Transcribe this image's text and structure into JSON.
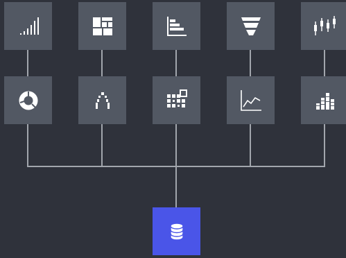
{
  "diagram": {
    "colors": {
      "background": "#2f323b",
      "tile": "#525863",
      "source_tile": "#4a55e8",
      "connector": "#a2a6ad",
      "icon": "#ffffff"
    },
    "top_row": [
      {
        "icon": "signal-bars-icon"
      },
      {
        "icon": "treemap-icon"
      },
      {
        "icon": "horizontal-bar-chart-icon"
      },
      {
        "icon": "funnel-chart-icon"
      },
      {
        "icon": "candlestick-chart-icon"
      }
    ],
    "bottom_row": [
      {
        "icon": "donut-chart-icon"
      },
      {
        "icon": "network-graph-icon"
      },
      {
        "icon": "heatmap-grid-icon"
      },
      {
        "icon": "line-chart-icon"
      },
      {
        "icon": "stacked-column-chart-icon"
      }
    ],
    "source": {
      "icon": "database-icon"
    }
  }
}
